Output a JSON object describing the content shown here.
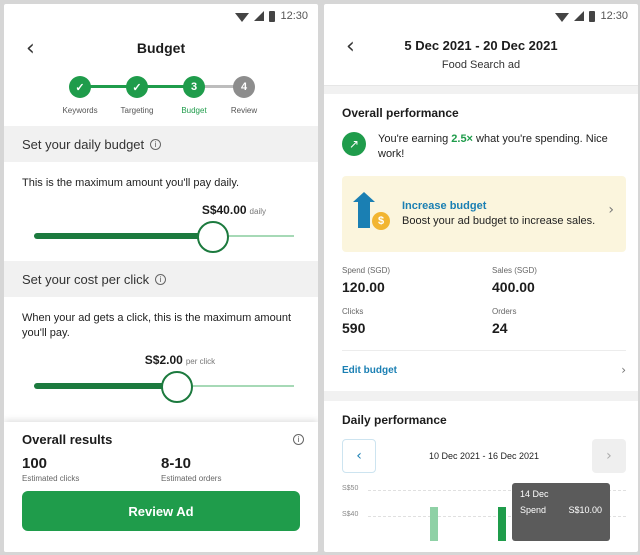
{
  "status_bar": {
    "time": "12:30"
  },
  "left": {
    "title": "Budget",
    "steps": [
      {
        "label": "Keywords",
        "mark": "✓",
        "state": "done"
      },
      {
        "label": "Targeting",
        "mark": "✓",
        "state": "done"
      },
      {
        "label": "Budget",
        "mark": "3",
        "state": "active"
      },
      {
        "label": "Review",
        "mark": "4",
        "state": "todo"
      }
    ],
    "daily_budget": {
      "heading": "Set your daily budget",
      "description": "This is the maximum amount you'll pay daily.",
      "amount": "S$40.00",
      "unit": "daily",
      "slider_level": 0.69
    },
    "cost_per_click": {
      "heading": "Set your cost per click",
      "description": "When your ad gets a click, this is the maximum amount you'll pay.",
      "amount": "S$2.00",
      "unit": "per click",
      "slider_level": 0.55
    },
    "overall_results": {
      "title": "Overall results",
      "clicks_value": "100",
      "clicks_label": "Estimated clicks",
      "orders_value": "8-10",
      "orders_label": "Estimated orders",
      "button_label": "Review Ad"
    }
  },
  "right": {
    "title": "5 Dec 2021 - 20 Dec 2021",
    "subtitle": "Food Search ad",
    "overall_performance": {
      "title": "Overall performance",
      "earning_prefix": "You're earning",
      "earning_multiplier": "2.5×",
      "earning_suffix": "what you're spending. Nice work!"
    },
    "promo": {
      "title": "Increase budget",
      "body": "Boost your ad budget to increase sales."
    },
    "stats": {
      "spend_label": "Spend (SGD)",
      "spend_value": "120.00",
      "sales_label": "Sales (SGD)",
      "sales_value": "400.00",
      "clicks_label": "Clicks",
      "clicks_value": "590",
      "orders_label": "Orders",
      "orders_value": "24"
    },
    "edit_budget_label": "Edit budget",
    "daily_performance": {
      "title": "Daily performance",
      "range": "10 Dec 2021 - 16 Dec 2021",
      "y_ticks": [
        "S$50",
        "S$40"
      ],
      "tooltip": {
        "date": "14 Dec",
        "spend_label": "Spend",
        "spend_value": "S$10.00"
      }
    }
  }
}
